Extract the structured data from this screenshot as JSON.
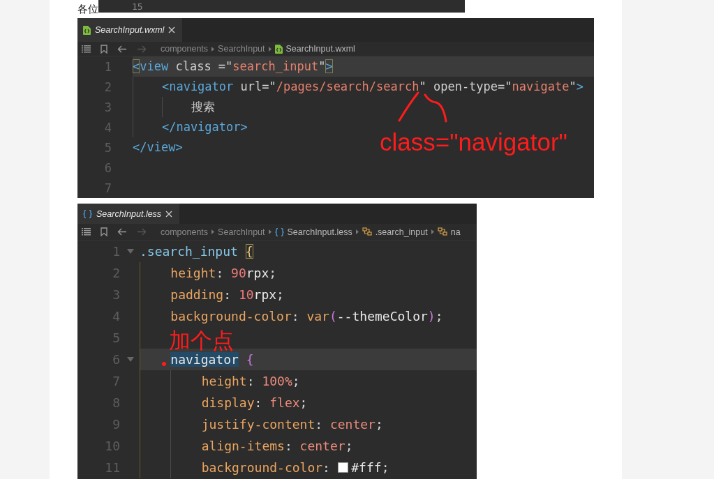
{
  "intro_text": "各位",
  "top_strip": {
    "line_number": "15"
  },
  "editors": [
    {
      "tab": {
        "label": "SearchInput.wxml",
        "kind": "wxml",
        "selected": true
      },
      "breadcrumbs": [
        {
          "text": "components",
          "kind": "folder"
        },
        {
          "text": "SearchInput",
          "kind": "folder"
        },
        {
          "text": "SearchInput.wxml",
          "kind": "wxml"
        }
      ],
      "lines": [
        {
          "number": "1",
          "current": true,
          "tokens": [
            {
              "text": "<",
              "kind": "bracket-match"
            },
            {
              "text": "view",
              "kind": "tag"
            },
            {
              "text": " class ",
              "kind": "attr"
            },
            {
              "text": "=",
              "kind": "punct"
            },
            {
              "text": "\"",
              "kind": "punct"
            },
            {
              "text": "search_input",
              "kind": "string"
            },
            {
              "text": "\"",
              "kind": "punct"
            },
            {
              "text": ">",
              "kind": "bracket-match"
            }
          ],
          "children": [
            {
              "number": "2",
              "current": false,
              "tokens": [
                {
                  "text": "<navigator",
                  "kind": "tag"
                },
                {
                  "text": " url",
                  "kind": "attr"
                },
                {
                  "text": "=",
                  "kind": "punct"
                },
                {
                  "text": "\"",
                  "kind": "punct"
                },
                {
                  "text": "/pages/search/search",
                  "kind": "string"
                },
                {
                  "text": "\"",
                  "kind": "punct"
                },
                {
                  "text": " open-type",
                  "kind": "attr"
                },
                {
                  "text": "=",
                  "kind": "punct"
                },
                {
                  "text": "\"",
                  "kind": "punct"
                },
                {
                  "text": "navigate",
                  "kind": "string"
                },
                {
                  "text": "\"",
                  "kind": "punct"
                },
                {
                  "text": ">",
                  "kind": "tag"
                }
              ],
              "children": [
                {
                  "number": "3",
                  "current": false,
                  "tokens": [
                    {
                      "text": "搜索",
                      "kind": "text"
                    }
                  ]
                }
              ]
            },
            {
              "number": "4",
              "current": false,
              "tokens": [
                {
                  "text": "</navigator>",
                  "kind": "tag"
                }
              ]
            }
          ]
        },
        {
          "number": "5",
          "current": false,
          "tokens": [
            {
              "text": "</view>",
              "kind": "tag"
            }
          ]
        },
        {
          "number": "6",
          "current": false
        },
        {
          "number": "7",
          "current": false
        }
      ],
      "annotation": {
        "text": "class=\"navigator\"",
        "kind": "note"
      }
    },
    {
      "tab": {
        "label": "SearchInput.less",
        "kind": "less",
        "selected": true
      },
      "breadcrumbs": [
        {
          "text": "components",
          "kind": "folder"
        },
        {
          "text": "SearchInput",
          "kind": "folder"
        },
        {
          "text": "SearchInput.less",
          "kind": "less"
        },
        {
          "text": ".search_input",
          "kind": "rule"
        },
        {
          "text": "na",
          "kind": "rule"
        }
      ],
      "lines": [
        {
          "number": "1",
          "current": false,
          "foldable": true,
          "tokens": [
            {
              "text": ".search_input ",
              "kind": "selector"
            },
            {
              "text": "{",
              "kind": "brace-match"
            }
          ],
          "children": [
            {
              "number": "2",
              "current": false,
              "tokens": [
                {
                  "text": "height",
                  "kind": "property"
                },
                {
                  "text": ": ",
                  "kind": "punct"
                },
                {
                  "text": "90",
                  "kind": "number"
                },
                {
                  "text": "rpx",
                  "kind": "unit"
                },
                {
                  "text": ";",
                  "kind": "punct"
                }
              ]
            },
            {
              "number": "3",
              "current": false,
              "tokens": [
                {
                  "text": "padding",
                  "kind": "property"
                },
                {
                  "text": ": ",
                  "kind": "punct"
                },
                {
                  "text": "10",
                  "kind": "number"
                },
                {
                  "text": "rpx",
                  "kind": "unit"
                },
                {
                  "text": ";",
                  "kind": "punct"
                }
              ]
            },
            {
              "number": "4",
              "current": false,
              "tokens": [
                {
                  "text": "background-color",
                  "kind": "property"
                },
                {
                  "text": ": ",
                  "kind": "punct"
                },
                {
                  "text": "var",
                  "kind": "function"
                },
                {
                  "text": "(",
                  "kind": "paren"
                },
                {
                  "text": "--themeColor",
                  "kind": "unit"
                },
                {
                  "text": ")",
                  "kind": "paren"
                },
                {
                  "text": ";",
                  "kind": "punct"
                }
              ]
            },
            {
              "number": "5",
              "current": false
            },
            {
              "number": "6",
              "current": true,
              "foldable": true,
              "tokens": [
                {
                  "text": "navigator",
                  "kind": "selected"
                },
                {
                  "text": " {",
                  "kind": "paren"
                }
              ],
              "children": [
                {
                  "number": "7",
                  "current": false,
                  "tokens": [
                    {
                      "text": "height",
                      "kind": "property"
                    },
                    {
                      "text": ": ",
                      "kind": "punct"
                    },
                    {
                      "text": "100%",
                      "kind": "value"
                    },
                    {
                      "text": ";",
                      "kind": "punct"
                    }
                  ]
                },
                {
                  "number": "8",
                  "current": false,
                  "tokens": [
                    {
                      "text": "display",
                      "kind": "property"
                    },
                    {
                      "text": ": ",
                      "kind": "punct"
                    },
                    {
                      "text": "flex",
                      "kind": "value"
                    },
                    {
                      "text": ";",
                      "kind": "punct"
                    }
                  ]
                },
                {
                  "number": "9",
                  "current": false,
                  "tokens": [
                    {
                      "text": "justify-content",
                      "kind": "property"
                    },
                    {
                      "text": ": ",
                      "kind": "punct"
                    },
                    {
                      "text": "center",
                      "kind": "value"
                    },
                    {
                      "text": ";",
                      "kind": "punct"
                    }
                  ]
                },
                {
                  "number": "10",
                  "current": false,
                  "tokens": [
                    {
                      "text": "align-items",
                      "kind": "property"
                    },
                    {
                      "text": ": ",
                      "kind": "punct"
                    },
                    {
                      "text": "center",
                      "kind": "value"
                    },
                    {
                      "text": ";",
                      "kind": "punct"
                    }
                  ]
                },
                {
                  "number": "11",
                  "current": false,
                  "tokens": [
                    {
                      "text": "background-color",
                      "kind": "property"
                    },
                    {
                      "text": ": ",
                      "kind": "punct"
                    },
                    {
                      "text": "#fff",
                      "kind": "color-value"
                    },
                    {
                      "text": ";",
                      "kind": "punct"
                    }
                  ]
                }
              ]
            }
          ]
        }
      ],
      "annotation": {
        "text": "加个点",
        "kind": "note"
      }
    }
  ]
}
